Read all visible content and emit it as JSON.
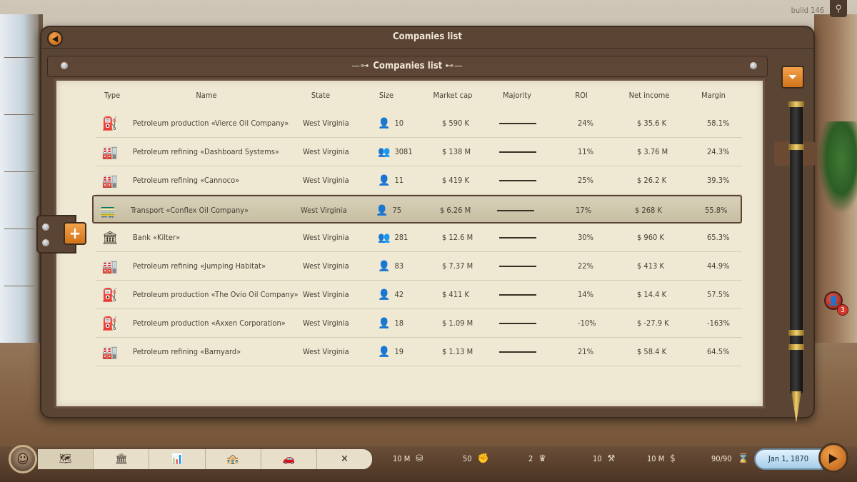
{
  "build_label": "build 146",
  "window": {
    "title": "Companies list"
  },
  "panel": {
    "title": "Companies list",
    "deco_left": "—⊶ ",
    "deco_right": " ⊷—"
  },
  "columns": [
    "Type",
    "Name",
    "State",
    "Size",
    "Market cap",
    "Majority",
    "ROI",
    "Net income",
    "Margin"
  ],
  "rows": [
    {
      "type_icon": "oil-pump-icon",
      "type_glyph": "⛽",
      "name": "Petroleum production «Vierce Oil Company»",
      "state": "West Virginia",
      "size_icon": "person-one-icon",
      "size_glyph": "👤",
      "size": "10",
      "market_cap": "$ 590 K",
      "roi": "24%",
      "net_income": "$ 35.6 K",
      "margin": "58.1%"
    },
    {
      "type_icon": "refinery-icon",
      "type_glyph": "🏭",
      "name": "Petroleum refining «Dashboard Systems»",
      "state": "West Virginia",
      "size_icon": "person-three-icon",
      "size_glyph": "👥",
      "size": "3081",
      "market_cap": "$ 138 M",
      "roi": "11%",
      "net_income": "$ 3.76 M",
      "margin": "24.3%"
    },
    {
      "type_icon": "refinery-icon",
      "type_glyph": "🏭",
      "name": "Petroleum refining «Cannoco»",
      "state": "West Virginia",
      "size_icon": "person-one-icon",
      "size_glyph": "👤",
      "size": "11",
      "market_cap": "$ 419 K",
      "roi": "25%",
      "net_income": "$ 26.2 K",
      "margin": "39.3%"
    },
    {
      "type_icon": "tank-car-icon",
      "type_glyph": "🚃",
      "name": "Transport «Conflex Oil Company»",
      "state": "West Virginia",
      "size_icon": "person-one-icon",
      "size_glyph": "👤",
      "size": "75",
      "market_cap": "$ 6.26 M",
      "roi": "17%",
      "net_income": "$ 268 K",
      "margin": "55.8%",
      "selected": true
    },
    {
      "type_icon": "bank-icon",
      "type_glyph": "🏛",
      "name": "Bank «Kilter»",
      "state": "West Virginia",
      "size_icon": "person-two-icon",
      "size_glyph": "👥",
      "size": "281",
      "market_cap": "$ 12.6 M",
      "roi": "30%",
      "net_income": "$ 960 K",
      "margin": "65.3%"
    },
    {
      "type_icon": "refinery-icon",
      "type_glyph": "🏭",
      "name": "Petroleum refining «Jumping Habitat»",
      "state": "West Virginia",
      "size_icon": "person-one-icon",
      "size_glyph": "👤",
      "size": "83",
      "market_cap": "$ 7.37 M",
      "roi": "22%",
      "net_income": "$ 413 K",
      "margin": "44.9%"
    },
    {
      "type_icon": "oil-pump-icon",
      "type_glyph": "⛽",
      "name": "Petroleum production «The Ovio Oil Company»",
      "state": "West Virginia",
      "size_icon": "person-one-icon",
      "size_glyph": "👤",
      "size": "42",
      "market_cap": "$ 411 K",
      "roi": "14%",
      "net_income": "$ 14.4 K",
      "margin": "57.5%"
    },
    {
      "type_icon": "oil-pump-icon",
      "type_glyph": "⛽",
      "name": "Petroleum production «Axxen Corporation»",
      "state": "West Virginia",
      "size_icon": "person-one-icon",
      "size_glyph": "👤",
      "size": "18",
      "market_cap": "$ 1.09 M",
      "roi": "-10%",
      "net_income": "$ -27.9 K",
      "margin": "-163%"
    },
    {
      "type_icon": "refinery-icon",
      "type_glyph": "🏭",
      "name": "Petroleum refining «Barnyard»",
      "state": "West Virginia",
      "size_icon": "person-one-icon",
      "size_glyph": "👤",
      "size": "19",
      "market_cap": "$ 1.13 M",
      "roi": "21%",
      "net_income": "$ 58.4 K",
      "margin": "64.5%"
    }
  ],
  "notifications": {
    "count": "3"
  },
  "bottom_bar": {
    "stats": [
      {
        "value": "10 M",
        "icon": "coins-icon",
        "glyph": "⛁"
      },
      {
        "value": "50",
        "icon": "fist-icon",
        "glyph": "✊"
      },
      {
        "value": "2",
        "icon": "crown-icon",
        "glyph": "♛"
      },
      {
        "value": "10",
        "icon": "hammer-icon",
        "glyph": "⚒"
      },
      {
        "value": "10 M",
        "icon": "dollar-icon",
        "glyph": "$"
      },
      {
        "value": "90/90",
        "icon": "hourglass-icon",
        "glyph": "⌛"
      }
    ],
    "date": "Jan 1, 1870"
  }
}
